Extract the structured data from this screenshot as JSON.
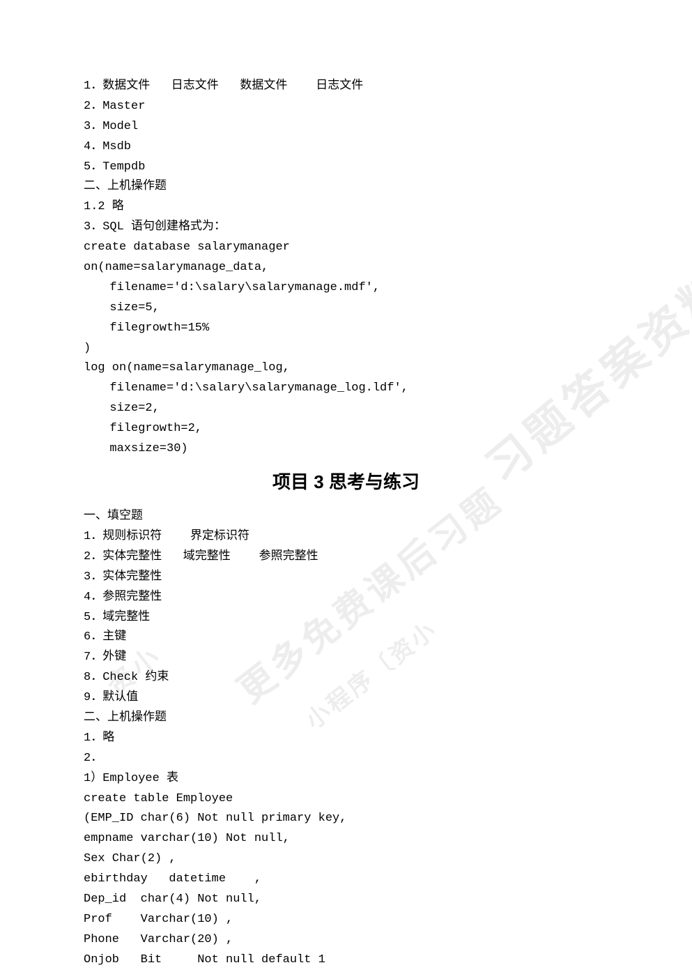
{
  "watermarks": {
    "wm1": "习题答案资料尽在",
    "wm2": "更多免费课后习题",
    "wm3": "资小",
    "wm4": "小程序〔资小"
  },
  "top": {
    "l1": "1．数据文件   日志文件   数据文件    日志文件",
    "l2": "2．Master",
    "l3": "3．Model",
    "l4": "4．Msdb",
    "l5": "5．Tempdb",
    "l6": "二、上机操作题",
    "l7": "1.2 略",
    "l8": "3．SQL 语句创建格式为：",
    "c1": "create database salarymanager",
    "c2": "on(name=salarymanage_data,",
    "c3": "filename='d:\\salary\\salarymanage.mdf',",
    "c4": "size=5,",
    "c5": "filegrowth=15%",
    "c6": ")",
    "c7": "log on(name=salarymanage_log,",
    "c8": "filename='d:\\salary\\salarymanage_log.ldf',",
    "c9": "size=2,",
    "c10": "filegrowth=2,",
    "c11": "maxsize=30)"
  },
  "heading": {
    "prefix": "项目 ",
    "num": "3",
    "suffix": " 思考与练习"
  },
  "sec3": {
    "h1": "一、填空题",
    "l1": "1．规则标识符    界定标识符",
    "l2": "2．实体完整性   域完整性    参照完整性",
    "l3": "3．实体完整性",
    "l4": "4．参照完整性",
    "l5": "5．域完整性",
    "l6": "6．主键",
    "l7": "7．外键",
    "l8": "8．Check 约束",
    "l9": "9．默认值",
    "h2": "二、上机操作题",
    "p1": "1．略",
    "p2": "2．",
    "p3": "1）Employee 表",
    "c1": "create table Employee",
    "c2": "(EMP_ID char(6) Not null primary key,",
    "c3": "empname varchar(10) Not null,",
    "c4": "Sex Char(2) ,",
    "c5": "ebirthday   datetime    ,",
    "c6": "Dep_id  char(4) Not null,",
    "c7": "Prof    Varchar(10) ,",
    "c8": "Phone   Varchar(20) ,",
    "c9": "Onjob   Bit     Not null default 1"
  }
}
